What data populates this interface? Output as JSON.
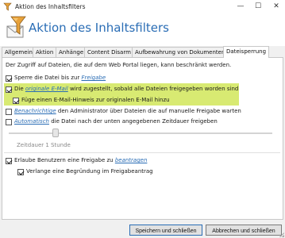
{
  "window": {
    "title": "Aktion des Inhaltsfilters",
    "minimize": "—",
    "maximize": "☐",
    "close": "✕"
  },
  "header": {
    "heading": "Aktion des Inhaltsfilters"
  },
  "tabs": [
    {
      "label": "Allgemein"
    },
    {
      "label": "Aktion"
    },
    {
      "label": "Anhänge"
    },
    {
      "label": "Content Disarm"
    },
    {
      "label": "Aufbewahrung von Dokumenten"
    },
    {
      "label": "Dateisperrung",
      "active": true
    }
  ],
  "panel": {
    "intro": "Der Zugriff auf Dateien, die auf dem Web Portal liegen, kann beschränkt werden.",
    "options": {
      "sperre": {
        "checked": true,
        "text": "Sperre die Datei bis zur ",
        "link": "Freigabe"
      },
      "original": {
        "checked": true,
        "text_pre": "Die ",
        "link": "originale E-Mail",
        "text_post": " wird zugestellt, sobald alle Dateien freigegeben worden sind"
      },
      "hinweis": {
        "checked": true,
        "text": "Füge einen E-Mail-Hinweis zur originalen E-Mail hinzu"
      },
      "benachrichtige": {
        "checked": false,
        "link": "Benachrichtige",
        "text": " den Administrator über Dateien die auf manuelle Freigabe warten"
      },
      "automatisch": {
        "checked": false,
        "link": "Automatisch",
        "text": " die Datei nach der unten angegebenen Zeitdauer freigeben"
      },
      "beantragen": {
        "checked": true,
        "text": "Erlaube Benutzern eine Freigabe zu ",
        "link": "beantragen"
      },
      "begruendung": {
        "checked": true,
        "text": "Verlange eine Begründung im Freigabeantrag"
      }
    },
    "slider": {
      "label": "Zeitdauer 1 Stunde",
      "value_fraction": 0.17
    }
  },
  "footer": {
    "save_label": "Speichern und schließen",
    "cancel_label": "Abbrechen und schließen"
  },
  "colors": {
    "accent": "#2a6db5",
    "highlight": "#d8ea72"
  }
}
